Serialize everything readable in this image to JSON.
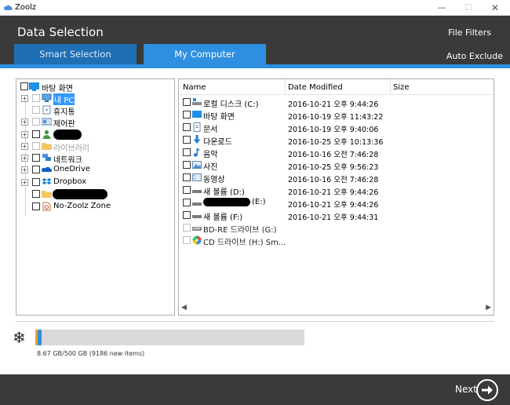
{
  "window": {
    "title": "Zoolz",
    "controls": {
      "minimize": "—",
      "maximize": "☐",
      "close": "✕"
    }
  },
  "header": {
    "title": "Data Selection",
    "file_filters": "File Filters",
    "auto_exclude": "Auto Exclude",
    "tabs": [
      {
        "label": "Smart Selection",
        "active": false
      },
      {
        "label": "My Computer",
        "active": true
      }
    ]
  },
  "tree": {
    "items": [
      {
        "label": "바탕 화면",
        "icon": "desktop-icon"
      },
      {
        "label": "내 PC",
        "icon": "pc-icon",
        "selected": true
      },
      {
        "label": "휴지통",
        "icon": "recycle-bin-icon"
      },
      {
        "label": "제어판",
        "icon": "control-panel-icon"
      },
      {
        "label": "",
        "icon": "user-icon"
      },
      {
        "label": "라이브러리",
        "icon": "libraries-icon",
        "dimmed": true
      },
      {
        "label": "네트워크",
        "icon": "network-icon"
      },
      {
        "label": "OneDrive",
        "icon": "onedrive-icon"
      },
      {
        "label": "Dropbox",
        "icon": "dropbox-icon"
      },
      {
        "label": "",
        "icon": "folder-icon"
      },
      {
        "label": "No-Zoolz Zone",
        "icon": "no-zoolz-icon"
      }
    ]
  },
  "list": {
    "columns": [
      "Name",
      "Date Modified",
      "Size"
    ],
    "rows": [
      {
        "name": "로컬 디스크 (C:)",
        "date": "2016-10-21 오후 9:44:26",
        "icon": "local-disk-icon"
      },
      {
        "name": "바탕 화면",
        "date": "2016-10-19 오후 11:43:22",
        "icon": "desktop-icon"
      },
      {
        "name": "문서",
        "date": "2016-10-19 오후 9:40:06",
        "icon": "documents-icon"
      },
      {
        "name": "다운로드",
        "date": "2016-10-25 오후 10:13:36",
        "icon": "downloads-icon"
      },
      {
        "name": "음악",
        "date": "2016-10-16 오전 7:46:28",
        "icon": "music-icon"
      },
      {
        "name": "사진",
        "date": "2016-10-25 오후 9:56:23",
        "icon": "pictures-icon"
      },
      {
        "name": "동영상",
        "date": "2016-10-16 오전 7:46:28",
        "icon": "videos-icon"
      },
      {
        "name": "새 볼륨 (D:)",
        "date": "2016-10-21 오후 9:44:26",
        "icon": "drive-icon"
      },
      {
        "name": "(E:)",
        "date": "2016-10-21 오후 9:44:26",
        "icon": "drive-icon"
      },
      {
        "name": "새 볼륨 (F:)",
        "date": "2016-10-21 오후 9:44:31",
        "icon": "drive-icon"
      },
      {
        "name": "BD-RE 드라이브 (G:)",
        "date": "",
        "icon": "bd-drive-icon"
      },
      {
        "name": "CD 드라이브 (H:) Sm...",
        "date": "",
        "icon": "cd-drive-icon"
      }
    ]
  },
  "storage": {
    "text": "8.67 GB/500 GB (9186 new items)",
    "used_fraction": 0.017
  },
  "footer": {
    "next_label": "Next"
  },
  "colors": {
    "accent": "#2e8fe0",
    "header_bg": "#3a3a3a",
    "tab_inactive": "#1f6fb5"
  }
}
